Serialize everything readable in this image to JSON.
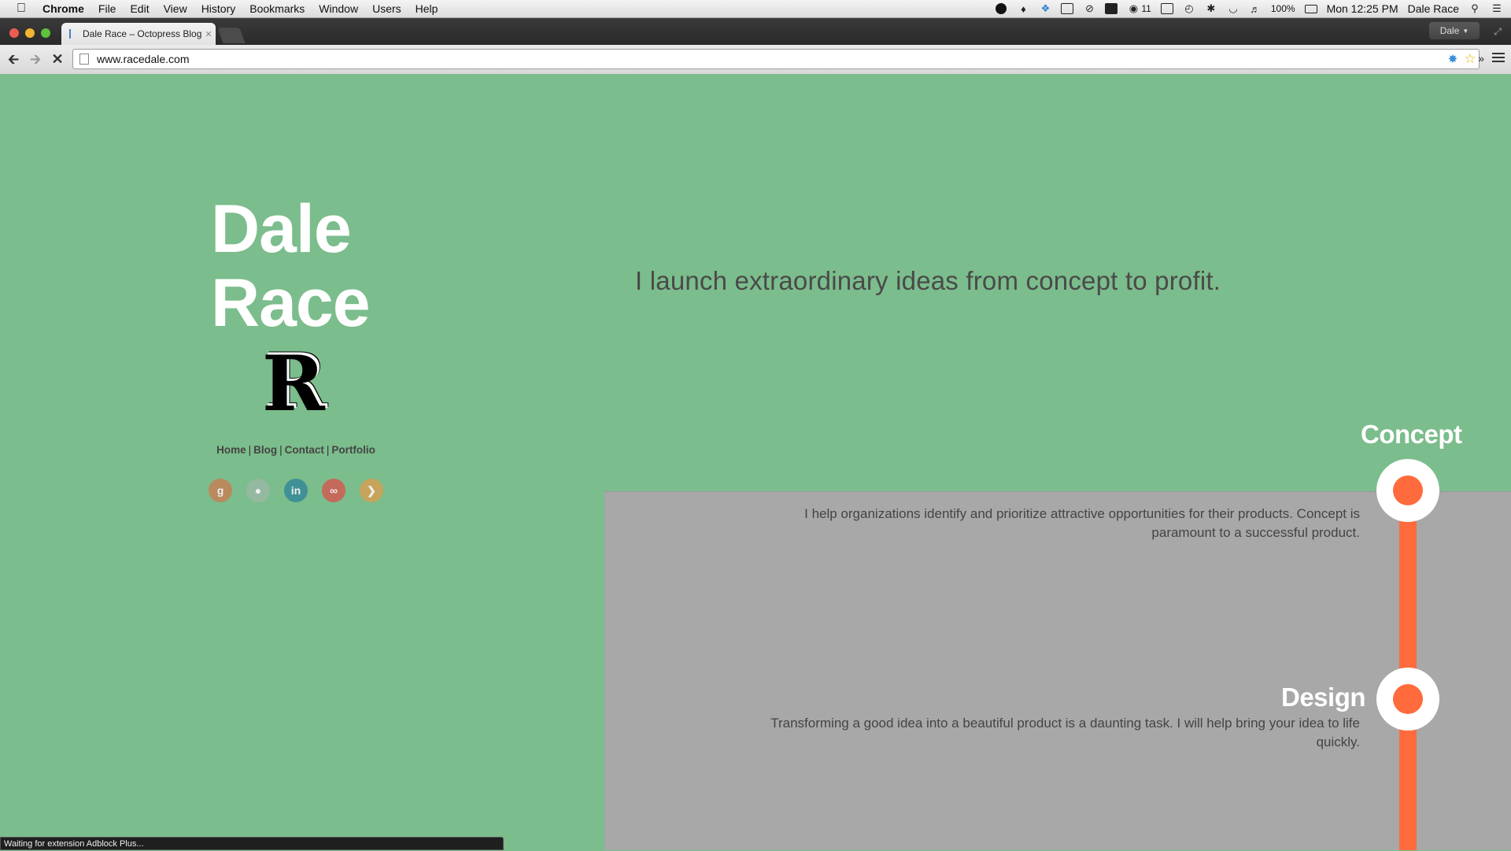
{
  "menubar": {
    "app_name": "Chrome",
    "menus": [
      "File",
      "Edit",
      "View",
      "History",
      "Bookmarks",
      "Window",
      "Users",
      "Help"
    ],
    "notification_count": "11",
    "battery": "100%",
    "clock": "Mon 12:25 PM",
    "user": "Dale Race"
  },
  "browser": {
    "tab_title": "Dale Race – Octopress Blog",
    "profile": "Dale",
    "url": "www.racedale.com",
    "status": "Waiting for extension Adblock Plus..."
  },
  "site": {
    "name_line1": "Dale",
    "name_line2": "Race",
    "logo_letter": "R",
    "nav": [
      "Home",
      "Blog",
      "Contact",
      "Portfolio"
    ],
    "social_icons": [
      "google-plus-icon",
      "github-icon",
      "linkedin-icon",
      "lastfm-icon",
      "rss-icon"
    ],
    "tagline": "I launch extraordinary ideas from concept to profit.",
    "steps": [
      {
        "title": "Concept",
        "description": "I help organizations identify and prioritize attractive opportunities for their products. Concept is paramount to a successful product."
      },
      {
        "title": "Design",
        "description": "Transforming a good idea into a beautiful product is a daunting task. I will help bring your idea to life quickly."
      }
    ]
  },
  "colors": {
    "page_green": "#7bbd8c",
    "panel_gray": "#a8a8a8",
    "accent_orange": "#ff6b3d",
    "social_google": "#b98a5e",
    "social_github": "#94b9a0",
    "social_linkedin": "#3f9196",
    "social_lastfm": "#c46a5b",
    "social_rss": "#c7a45b"
  }
}
